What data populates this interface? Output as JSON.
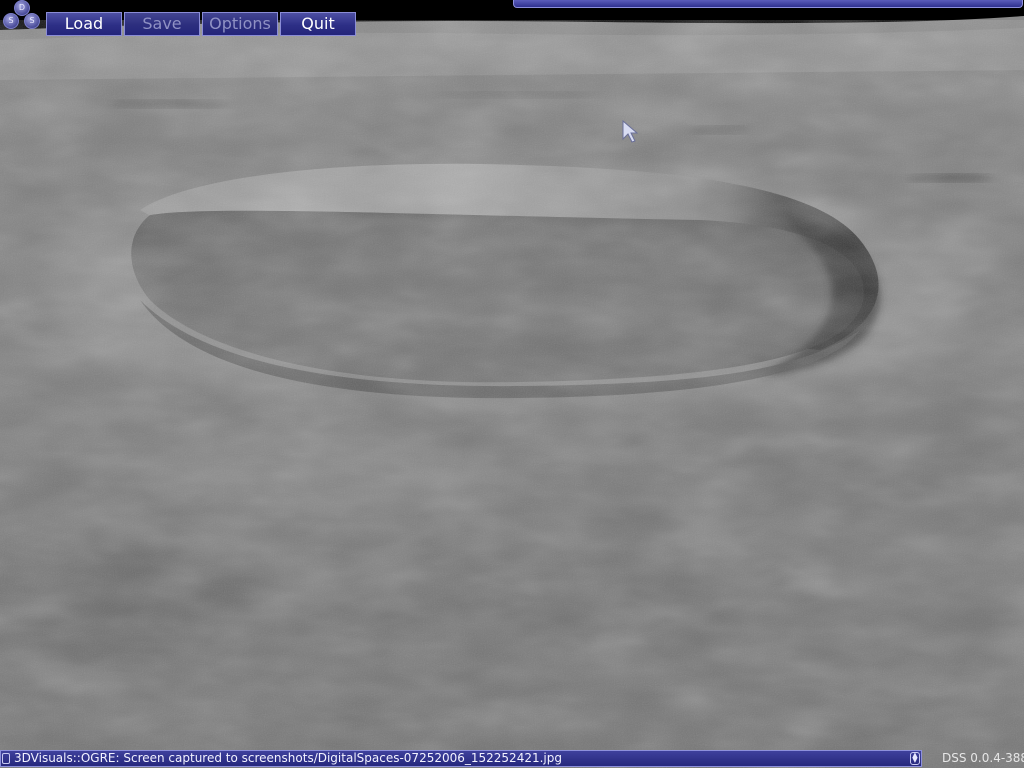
{
  "app": {
    "logo_letters": [
      "D",
      "S",
      "S"
    ]
  },
  "menu": {
    "items": [
      {
        "label": "Load",
        "enabled": true
      },
      {
        "label": "Save",
        "enabled": false
      },
      {
        "label": "Options",
        "enabled": false
      },
      {
        "label": "Quit",
        "enabled": true
      }
    ]
  },
  "console": {
    "message": "3DVisuals::OGRE: Screen captured to screenshots/DigitalSpaces-07252006_152252421.jpg"
  },
  "status": {
    "version": "DSS 0.0.4-388"
  },
  "colors": {
    "ui_accent": "#2d2f86",
    "ui_border": "#8a8cd6",
    "terrain": "#7e7e7e"
  },
  "icons": {
    "cursor": "mouse-pointer-icon",
    "scroll": "scroll-arrows-icon"
  }
}
